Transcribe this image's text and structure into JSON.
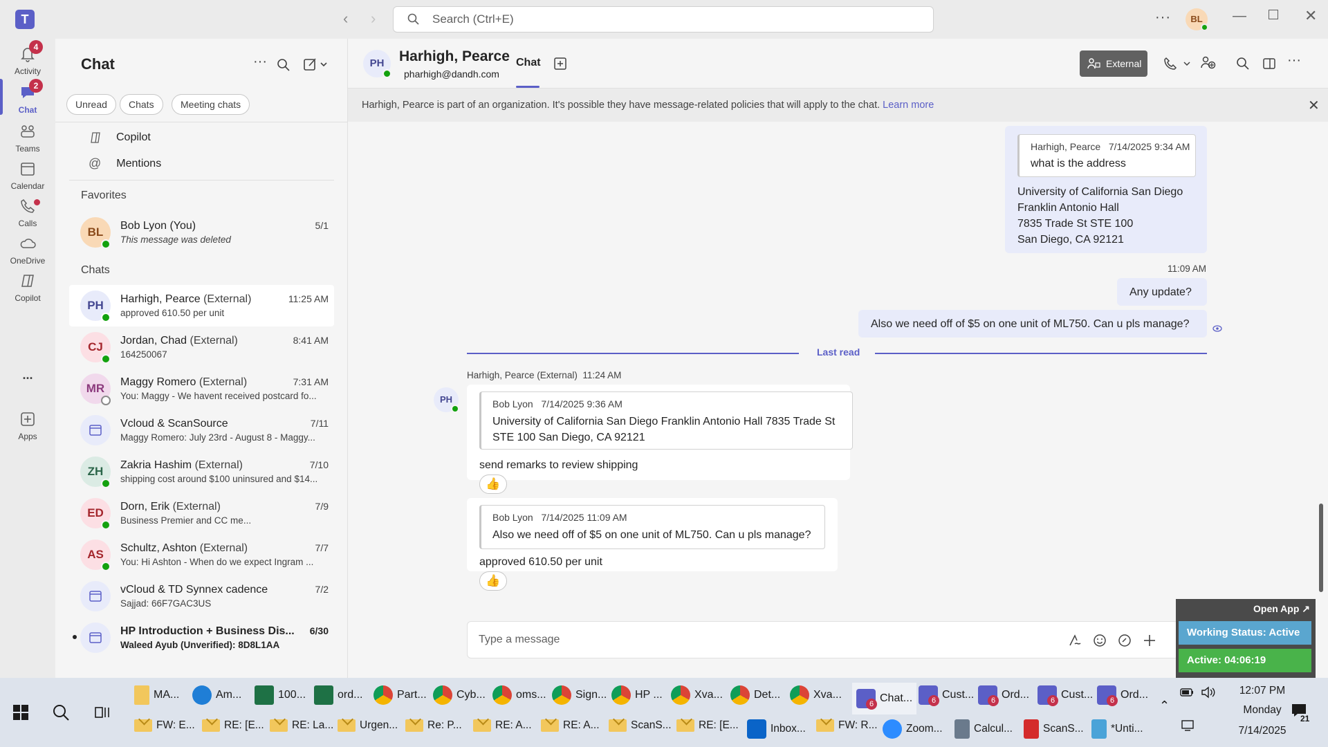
{
  "titlebar": {
    "search_placeholder": "Search (Ctrl+E)",
    "avatar_initials": "BL"
  },
  "rail": {
    "items": [
      {
        "label": "Activity",
        "badge": "4"
      },
      {
        "label": "Chat",
        "badge": "2"
      },
      {
        "label": "Teams"
      },
      {
        "label": "Calendar"
      },
      {
        "label": "Calls"
      },
      {
        "label": "OneDrive"
      },
      {
        "label": "Copilot"
      },
      {
        "label": "..."
      },
      {
        "label": "Apps"
      }
    ]
  },
  "chatlist": {
    "title": "Chat",
    "filters": [
      "Unread",
      "Chats",
      "Meeting chats"
    ],
    "top_items": [
      "Copilot",
      "Mentions"
    ],
    "favorites_label": "Favorites",
    "chats_label": "Chats",
    "favorites": [
      {
        "initials": "BL",
        "name": "Bob Lyon (You)",
        "ext": "",
        "preview": "This message was deleted",
        "time": "5/1"
      }
    ],
    "chats": [
      {
        "initials": "PH",
        "name": "Harhigh, Pearce",
        "ext": "(External)",
        "preview": "approved 610.50 per unit",
        "time": "11:25 AM"
      },
      {
        "initials": "CJ",
        "name": "Jordan, Chad",
        "ext": "(External)",
        "preview": "164250067",
        "time": "8:41 AM"
      },
      {
        "initials": "MR",
        "name": "Maggy Romero",
        "ext": "(External)",
        "preview": "You: Maggy - We havent received postcard fo...",
        "time": "7:31 AM"
      },
      {
        "initials": "",
        "name": "Vcloud & ScanSource",
        "ext": "",
        "preview": "Maggy Romero: July 23rd - August 8 - Maggy...",
        "time": "7/11"
      },
      {
        "initials": "ZH",
        "name": "Zakria Hashim",
        "ext": "(External)",
        "preview": "shipping cost around $100 uninsured and $14...",
        "time": "7/10"
      },
      {
        "initials": "ED",
        "name": "Dorn, Erik",
        "ext": "(External)",
        "preview": "Business Premier and CC me...",
        "time": "7/9"
      },
      {
        "initials": "AS",
        "name": "Schultz, Ashton",
        "ext": "(External)",
        "preview": "You: Hi Ashton -  When do we expect Ingram ...",
        "time": "7/7"
      },
      {
        "initials": "",
        "name": "vCloud & TD Synnex cadence",
        "ext": "",
        "preview": "Sajjad: 66F7GAC3US",
        "time": "7/2"
      },
      {
        "initials": "",
        "name": "HP Introduction + Business Dis...",
        "ext": "",
        "preview": "Waleed Ayub (Unverified): 8D8L1AA",
        "time": "6/30"
      }
    ]
  },
  "header": {
    "initials": "PH",
    "name": "Harhigh, Pearce",
    "email": "pharhigh@dandh.com",
    "tab": "Chat",
    "external_label": "External"
  },
  "banner": {
    "text": "Harhigh, Pearce is part of an organization. It's possible they have message-related policies that will apply to the chat.",
    "link": "Learn more"
  },
  "messages": {
    "m1_quote_author": "Harhigh, Pearce",
    "m1_quote_time": "7/14/2025 9:34 AM",
    "m1_quote_text": "what is the address",
    "m1_lines": [
      "University of California San Diego",
      "Franklin Antonio Hall",
      "7835 Trade St STE 100",
      "San Diego, CA 92121"
    ],
    "m2_time": "11:09 AM",
    "m2_text": "Any update?",
    "m3_text": "Also we need off of $5 on one unit of ML750. Can u pls manage?",
    "last_read": "Last read",
    "other_header": "Harhigh, Pearce (External)  11:24 AM",
    "other_initials": "PH",
    "o1_quote_author": "Bob Lyon",
    "o1_quote_time": "7/14/2025 9:36 AM",
    "o1_quote_text": "University of California San Diego Franklin Antonio Hall 7835 Trade St STE 100 San Diego, CA 92121",
    "o1_text": "send remarks to review shipping",
    "o2_quote_author": "Bob Lyon",
    "o2_quote_time": "7/14/2025 11:09 AM",
    "o2_quote_text": "Also we need off of $5 on one unit of ML750. Can u pls manage?",
    "o2_text": "approved 610.50 per unit"
  },
  "compose": {
    "placeholder": "Type a message"
  },
  "widget": {
    "open_app": "Open App ↗",
    "status": "Working Status: Active",
    "active": "Active: 04:06:19"
  },
  "taskbar": {
    "row1": [
      "MA...",
      "Am...",
      "100...",
      "ord...",
      "Part...",
      "Cyb...",
      "oms...",
      "Sign...",
      "HP ...",
      "Xva...",
      "Det...",
      "Xva...",
      "Chat...",
      "Cust...",
      "Ord...",
      "Cust...",
      "Ord..."
    ],
    "row2": [
      "FW: E...",
      "RE: [E...",
      "RE: La...",
      "Urgen...",
      "Re: P...",
      "RE: A...",
      "RE: A...",
      "ScanS...",
      "RE: [E...",
      "Inbox...",
      "FW: R...",
      "Zoom...",
      "Calcul...",
      "ScanS...",
      "*Unti..."
    ],
    "teams_badge": "6",
    "time": "12:07 PM",
    "day": "Monday",
    "date": "7/14/2025",
    "notif_count": "21"
  }
}
